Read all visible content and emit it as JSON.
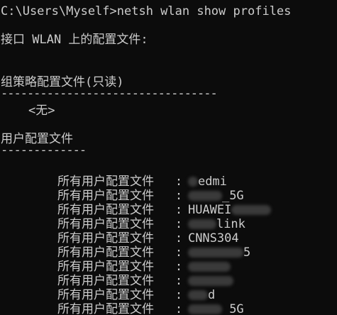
{
  "terminal": {
    "prompt_line": "C:\\Users\\Myself>netsh wlan show profiles",
    "interface_line": "接口 WLAN 上的配置文件:",
    "group_policy": {
      "heading": "组策略配置文件(只读)",
      "separator": "---------------------------------",
      "none_label": "<无>"
    },
    "user_profiles": {
      "heading": "用户配置文件",
      "separator": "-------------",
      "rows": [
        {
          "key": "所有用户配置文件",
          "colon": ":",
          "value": "edmi"
        },
        {
          "key": "所有用户配置文件",
          "colon": ":",
          "value": "_5G"
        },
        {
          "key": "所有用户配置文件",
          "colon": ":",
          "value": "HUAWEI"
        },
        {
          "key": "所有用户配置文件",
          "colon": ":",
          "value": "link"
        },
        {
          "key": "所有用户配置文件",
          "colon": ":",
          "value": "CNNS304"
        },
        {
          "key": "所有用户配置文件",
          "colon": ":",
          "value": "5"
        },
        {
          "key": "所有用户配置文件",
          "colon": ":",
          "value": ""
        },
        {
          "key": "所有用户配置文件",
          "colon": ":",
          "value": ""
        },
        {
          "key": "所有用户配置文件",
          "colon": ":",
          "value": "d"
        },
        {
          "key": "所有用户配置文件",
          "colon": ":",
          "value": "_5G"
        }
      ]
    }
  },
  "colors": {
    "background": "#0c0c0c",
    "foreground": "#cccccc"
  }
}
